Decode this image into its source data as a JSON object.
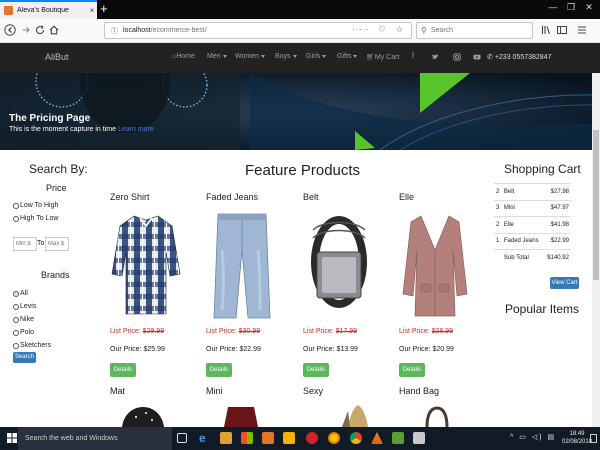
{
  "browser": {
    "tab_title": "Aleva's Boutique",
    "tab_close": "×",
    "new_tab": "+",
    "url_host": "localhost",
    "url_path": "/ecommerce-best/",
    "url_tools": "··· ♡ ☆",
    "search_placeholder": "Search",
    "win_min": "—",
    "win_max": "❐",
    "win_close": "✕"
  },
  "site": {
    "brand": "AliBut",
    "menu": {
      "home": "Home",
      "men": "Men",
      "women": "Women",
      "boys": "Boys",
      "girls": "Girls",
      "gifts": "Gifts",
      "cart": "My Cart",
      "phone": "+233 0557382847"
    },
    "social_icons": [
      "facebook-icon",
      "twitter-icon",
      "instagram-icon",
      "youtube-icon"
    ]
  },
  "hero": {
    "title": "The Pricing Page",
    "subtitle_prefix": "This is the moment capture in time",
    "subtitle_link": "Learn more"
  },
  "filters": {
    "title": "Search By:",
    "price_heading": "Price",
    "price_options": [
      "Low To High",
      "High To Low"
    ],
    "min_placeholder": "Min $",
    "to_label": "To",
    "max_placeholder": "Max $",
    "brands_heading": "Brands",
    "brands": [
      "All",
      "Levis",
      "Nike",
      "Polo",
      "Sketchers"
    ],
    "selected_brand": "All",
    "search_button": "Search"
  },
  "products": {
    "heading": "Feature Products",
    "list_price_label": "List Price:",
    "our_price_label": "Our Price:",
    "details_label": "Details",
    "items": [
      {
        "name": "Zero Shirt",
        "list_price": "$29.99",
        "our_price": "$25.99"
      },
      {
        "name": "Faded Jeans",
        "list_price": "$30.99",
        "our_price": "$22.99"
      },
      {
        "name": "Belt",
        "list_price": "$17.99",
        "our_price": "$13.99"
      },
      {
        "name": "Elle",
        "list_price": "$26.99",
        "our_price": "$20.99"
      }
    ],
    "next_row": [
      "Mat",
      "Mini",
      "Sexy",
      "Hand Bag"
    ]
  },
  "cart": {
    "title": "Shopping Cart",
    "rows": [
      {
        "qty": "2",
        "item": "Belt",
        "price": "$27.98"
      },
      {
        "qty": "3",
        "item": "Mini",
        "price": "$47.97"
      },
      {
        "qty": "2",
        "item": "Elle",
        "price": "$41.98"
      },
      {
        "qty": "1",
        "item": "Faded Jeans",
        "price": "$22.99"
      }
    ],
    "subtotal_label": "Sub Total",
    "subtotal_value": "$140.92",
    "view_cart_button": "View Cart",
    "popular_title": "Popular Items"
  },
  "taskbar": {
    "search_placeholder": "Search the web and Windows",
    "time": "18:49",
    "date": "02/08/2018"
  },
  "colors": {
    "nav_bg": "#222222",
    "primary": "#337ab7",
    "success": "#5cb85c",
    "danger": "#c9302c"
  }
}
